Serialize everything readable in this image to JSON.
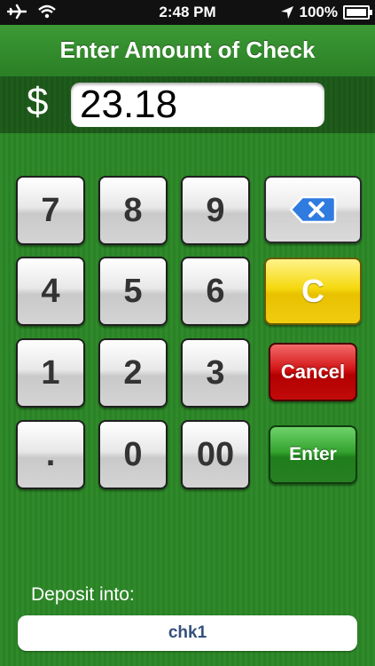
{
  "status_bar": {
    "time": "2:48 PM",
    "battery_text": "100%",
    "icons": [
      "airplane-icon",
      "wifi-icon",
      "location-arrow-icon",
      "battery-icon"
    ]
  },
  "header": {
    "title": "Enter Amount of Check"
  },
  "amount": {
    "currency_symbol": "$",
    "value": "23.18"
  },
  "keypad": {
    "rows": [
      [
        "7",
        "8",
        "9"
      ],
      [
        "4",
        "5",
        "6"
      ],
      [
        "1",
        "2",
        "3"
      ],
      [
        ".",
        "0",
        "00"
      ]
    ],
    "backspace_icon": "backspace-icon",
    "clear_label": "C",
    "cancel_label": "Cancel",
    "enter_label": "Enter"
  },
  "deposit": {
    "label": "Deposit into:",
    "account": "chk1"
  },
  "colors": {
    "background_green": "#2f8a2a",
    "clear_yellow": "#f5d90f",
    "cancel_red": "#d21515",
    "enter_green": "#34a32f",
    "account_text": "#34507c"
  }
}
